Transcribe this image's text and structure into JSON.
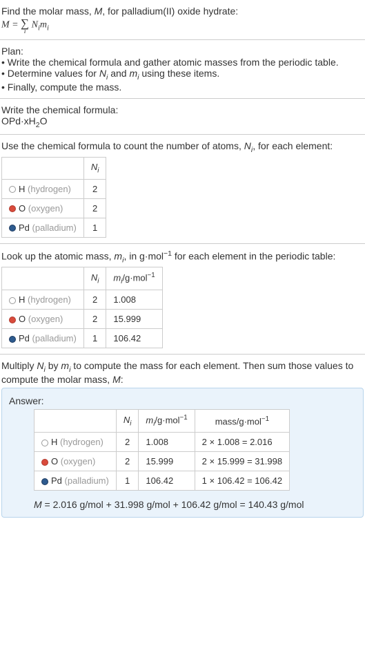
{
  "intro": {
    "line1_prefix": "Find the molar mass, ",
    "line1_var": "M",
    "line1_suffix": ", for palladium(II) oxide hydrate:",
    "eq_lhs": "M",
    "eq_eq": " = ",
    "eq_sigma_sub": "i",
    "eq_rhs_N": "N",
    "eq_rhs_i1": "i",
    "eq_rhs_m": "m",
    "eq_rhs_i2": "i"
  },
  "plan": {
    "title": "Plan:",
    "bullet1": "• Write the chemical formula and gather atomic masses from the periodic table.",
    "bullet2_prefix": "• Determine values for ",
    "bullet2_N": "N",
    "bullet2_i1": "i",
    "bullet2_and": " and ",
    "bullet2_m": "m",
    "bullet2_i2": "i",
    "bullet2_suffix": " using these items.",
    "bullet3": "• Finally, compute the mass."
  },
  "chemformula": {
    "title": "Write the chemical formula:",
    "formula_p1": "OPd·xH",
    "formula_sub": "2",
    "formula_p2": "O"
  },
  "count": {
    "title_prefix": "Use the chemical formula to count the number of atoms, ",
    "title_N": "N",
    "title_i": "i",
    "title_suffix": ", for each element:",
    "header_N": "N",
    "header_i": "i",
    "rows": [
      {
        "sym": "H",
        "name": "(hydrogen)",
        "circle": "circle-h",
        "n": "2"
      },
      {
        "sym": "O",
        "name": "(oxygen)",
        "circle": "circle-o",
        "n": "2"
      },
      {
        "sym": "Pd",
        "name": "(palladium)",
        "circle": "circle-pd",
        "n": "1"
      }
    ]
  },
  "lookup": {
    "title_prefix": "Look up the atomic mass, ",
    "title_m": "m",
    "title_i": "i",
    "title_mid": ", in g·mol",
    "title_exp": "−1",
    "title_suffix": " for each element in the periodic table:",
    "header_N": "N",
    "header_Ni": "i",
    "header_m": "m",
    "header_mi": "i",
    "header_unit": "/g·mol",
    "header_exp": "−1",
    "rows": [
      {
        "sym": "H",
        "name": "(hydrogen)",
        "circle": "circle-h",
        "n": "2",
        "m": "1.008"
      },
      {
        "sym": "O",
        "name": "(oxygen)",
        "circle": "circle-o",
        "n": "2",
        "m": "15.999"
      },
      {
        "sym": "Pd",
        "name": "(palladium)",
        "circle": "circle-pd",
        "n": "1",
        "m": "106.42"
      }
    ]
  },
  "multiply": {
    "text_prefix": "Multiply ",
    "N": "N",
    "Ni": "i",
    "by": " by ",
    "m": "m",
    "mi": "i",
    "mid": " to compute the mass for each element. Then sum those values to compute the molar mass, ",
    "M": "M",
    "suffix": ":"
  },
  "answer": {
    "label": "Answer:",
    "header_N": "N",
    "header_Ni": "i",
    "header_m": "m",
    "header_mi": "i",
    "header_munit": "/g·mol",
    "header_mexp": "−1",
    "header_mass": "mass/g·mol",
    "header_massexp": "−1",
    "rows": [
      {
        "sym": "H",
        "name": "(hydrogen)",
        "circle": "circle-h",
        "n": "2",
        "m": "1.008",
        "mass": "2 × 1.008 = 2.016"
      },
      {
        "sym": "O",
        "name": "(oxygen)",
        "circle": "circle-o",
        "n": "2",
        "m": "15.999",
        "mass": "2 × 15.999 = 31.998"
      },
      {
        "sym": "Pd",
        "name": "(palladium)",
        "circle": "circle-pd",
        "n": "1",
        "m": "106.42",
        "mass": "1 × 106.42 = 106.42"
      }
    ],
    "final_M": "M",
    "final_eq": " = 2.016 g/mol + 31.998 g/mol + 106.42 g/mol = 140.43 g/mol"
  }
}
